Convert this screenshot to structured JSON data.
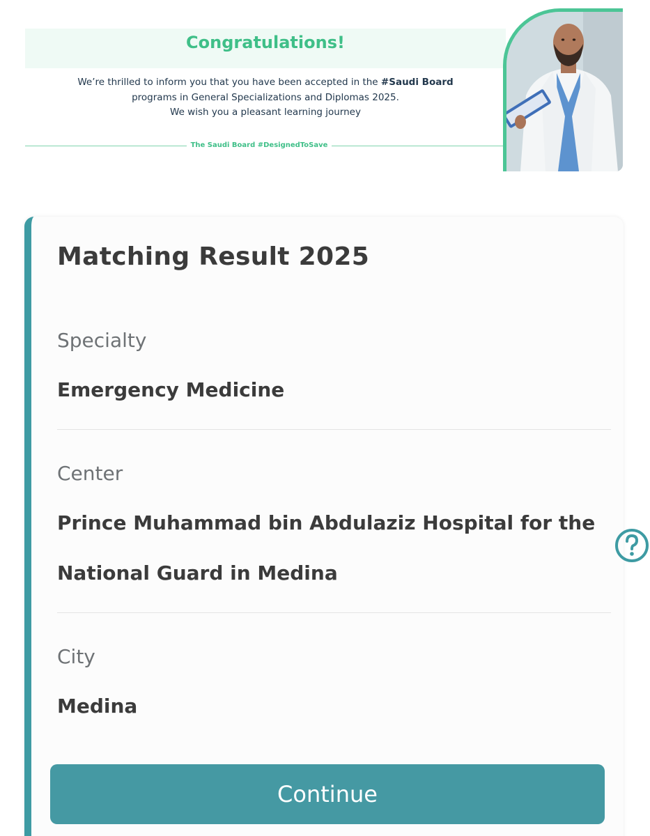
{
  "banner": {
    "heading": "Congratulations!",
    "message_part1": "We’re thrilled to inform you that you have been accepted in the ",
    "message_highlight": "#Saudi Board",
    "message_part2": " programs in General Specializations and Diplomas 2025.",
    "message_line3": "We wish you a pleasant learning journey",
    "hashtag": "The Saudi Board #DesignedToSave"
  },
  "card": {
    "title": "Matching Result 2025",
    "fields": [
      {
        "label": "Specialty",
        "value": "Emergency Medicine"
      },
      {
        "label": "Center",
        "value": "Prince Muhammad bin Abdulaziz Hospital for the National Guard in Medina"
      },
      {
        "label": "City",
        "value": "Medina"
      }
    ],
    "continue_label": "Continue"
  },
  "colors": {
    "accent": "#4599a3",
    "brand_green": "#3fbf88",
    "text_dark": "#3b3b3b",
    "text_muted": "#6e7275"
  },
  "icons": {
    "help": "help-circle-icon",
    "photo": "doctor-photo"
  }
}
